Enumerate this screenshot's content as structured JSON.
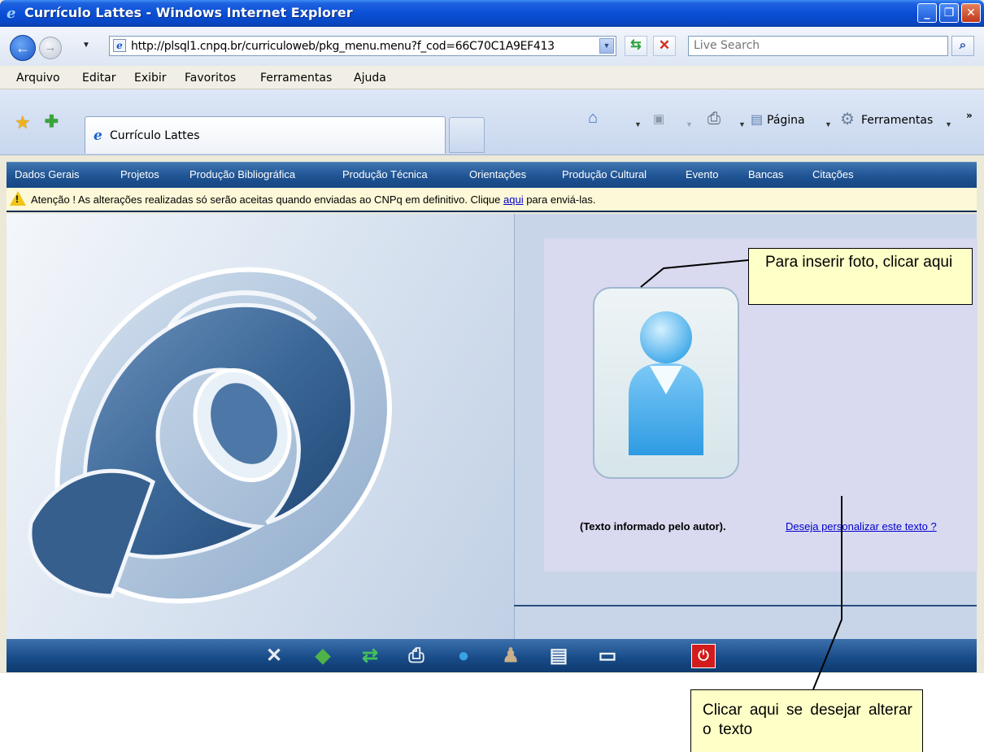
{
  "window": {
    "title": "Currículo Lattes - Windows Internet Explorer",
    "controls": {
      "minimize": "_",
      "maximize": "❐",
      "close": "✕"
    }
  },
  "address_bar": {
    "url": "http://plsql1.cnpq.br/curriculoweb/pkg_menu.menu?f_cod=66C70C1A9EF413",
    "search_placeholder": "Live Search"
  },
  "menu_bar": {
    "items": [
      "Arquivo",
      "Editar",
      "Exibir",
      "Favoritos",
      "Ferramentas",
      "Ajuda"
    ]
  },
  "tabs": {
    "active_label": "Currículo Lattes"
  },
  "command_bar": {
    "page_label": "Página",
    "tools_label": "Ferramentas",
    "overflow": "»"
  },
  "lattes_nav": {
    "items": [
      "Dados Gerais",
      "Projetos",
      "Produção Bibliográfica",
      "Produção Técnica",
      "Orientações",
      "Produção Cultural",
      "Evento",
      "Bancas",
      "Citações"
    ]
  },
  "warning": {
    "text_before": "Atenção ! As alterações realizadas só serão aceitas quando enviadas ao CNPq em definitivo. Clique ",
    "link": "aqui",
    "text_after": " para enviá-las."
  },
  "profile": {
    "author_text": "(Texto informado pelo autor).",
    "customize_link": "Deseja personalizar este texto ?"
  },
  "callouts": {
    "photo": "Para inserir foto, clicar aqui",
    "text": "Clicar aqui se desejar alterar o texto"
  },
  "bottom_toolbar": {
    "icons": [
      "tools-icon",
      "globe-arrow-icon",
      "refresh-icon",
      "printer-icon",
      "web-icon",
      "users-icon",
      "notebook-icon",
      "windows-icon",
      "power-icon"
    ]
  },
  "colors": {
    "titlebar": "#0a4fd6",
    "nav": "#1f5393",
    "callout": "#ffffc8",
    "warning_bg": "#fdf9d8",
    "power": "#d21c1c"
  }
}
